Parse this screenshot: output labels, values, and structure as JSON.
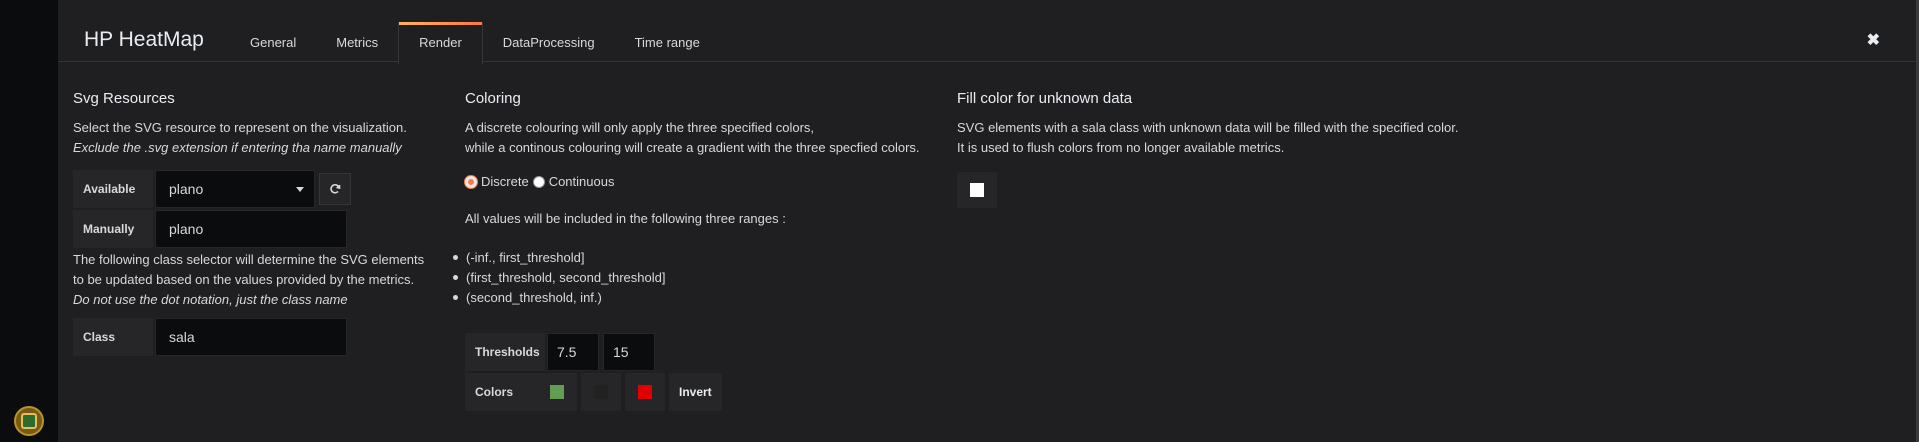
{
  "header": {
    "title": "HP HeatMap",
    "tabs": [
      {
        "label": "General"
      },
      {
        "label": "Metrics"
      },
      {
        "label": "Render"
      },
      {
        "label": "DataProcessing"
      },
      {
        "label": "Time range"
      }
    ],
    "active_tab": "Render",
    "close_icon": "✖"
  },
  "svg_resources": {
    "title": "Svg Resources",
    "desc1": "Select the SVG resource to represent on the visualization.",
    "desc2": "Exclude the .svg extension if entering tha name manually",
    "available_label": "Available",
    "available_value": "plano",
    "refresh_icon": "refresh-icon",
    "manually_label": "Manually",
    "manually_value": "plano",
    "class_desc1": "The following class selector will determine the SVG elements",
    "class_desc2": "to be updated based on the values provided by the metrics.",
    "class_desc3": "Do not use the dot notation, just the class name",
    "class_label": "Class",
    "class_value": "sala"
  },
  "coloring": {
    "title": "Coloring",
    "desc1": "A discrete colouring will only apply the three specified colors,",
    "desc2": "while a continous colouring will create a gradient with the three specfied colors.",
    "discrete_label": "Discrete",
    "continuous_label": "Continuous",
    "selected_mode": "Discrete",
    "ranges_intro": "All values will be included in the following three ranges :",
    "ranges": [
      "(-inf., first_threshold]",
      "(first_threshold, second_threshold]",
      "(second_threshold, inf.)"
    ],
    "thresholds_label": "Thresholds",
    "threshold1": "7.5",
    "threshold2": "15",
    "colors_label": "Colors",
    "colors": [
      "#629e51",
      "#222222",
      "#e30000"
    ],
    "invert_label": "Invert"
  },
  "fill_unknown": {
    "title": "Fill color for unknown data",
    "desc1": "SVG elements with a sala class with unknown data will be filled with the specified color.",
    "desc2": "It is used to flush colors from no longer available metrics.",
    "color": "#ffffff"
  },
  "accent": "#ff7941"
}
